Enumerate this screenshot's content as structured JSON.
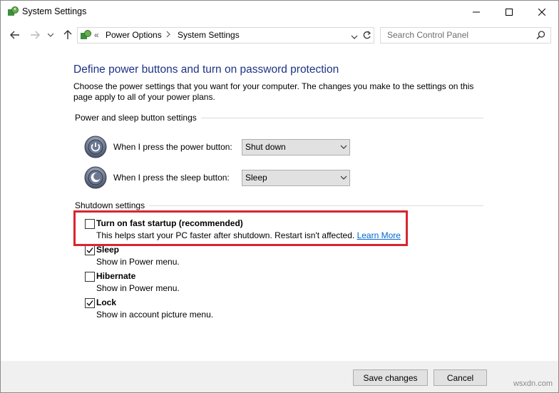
{
  "window": {
    "title": "System Settings"
  },
  "address": {
    "crumbs": [
      "Power Options",
      "System Settings"
    ],
    "separator": "«"
  },
  "search": {
    "placeholder": "Search Control Panel"
  },
  "main": {
    "heading": "Define power buttons and turn on password protection",
    "description": "Choose the power settings that you want for your computer. The changes you make to the settings on this page apply to all of your power plans.",
    "power_group_label": "Power and sleep button settings",
    "power_button_label": "When I press the power button:",
    "power_button_value": "Shut down",
    "sleep_button_label": "When I press the sleep button:",
    "sleep_button_value": "Sleep",
    "shutdown_group_label": "Shutdown settings"
  },
  "shutdown_options": [
    {
      "title": "Turn on fast startup (recommended)",
      "subtitle": "This helps start your PC faster after shutdown. Restart isn't affected.",
      "link": "Learn More",
      "checked": false
    },
    {
      "title": "Sleep",
      "subtitle": "Show in Power menu.",
      "checked": true
    },
    {
      "title": "Hibernate",
      "subtitle": "Show in Power menu.",
      "checked": false
    },
    {
      "title": "Lock",
      "subtitle": "Show in account picture menu.",
      "checked": true
    }
  ],
  "footer": {
    "save_label": "Save changes",
    "cancel_label": "Cancel"
  },
  "watermark": "wsxdn.com",
  "colors": {
    "heading": "#1e3287",
    "highlight_border": "#d9252f",
    "link": "#0066cc"
  }
}
